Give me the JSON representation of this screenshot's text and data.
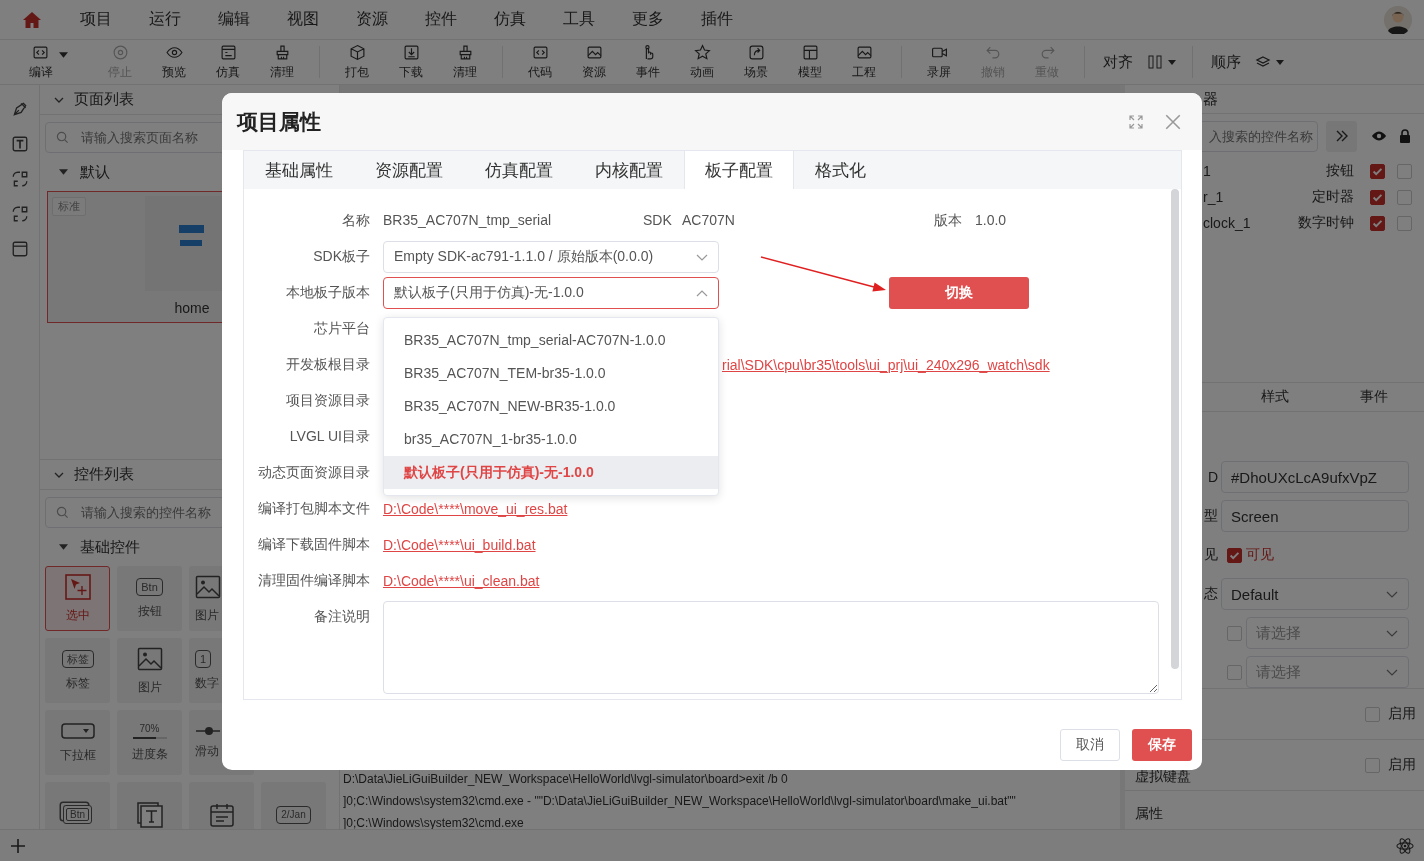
{
  "menu_bar": {
    "items": [
      "项目",
      "运行",
      "编辑",
      "视图",
      "资源",
      "控件",
      "仿真",
      "工具",
      "更多",
      "插件"
    ]
  },
  "toolbar": {
    "groups": [
      [
        {
          "label": "编译",
          "disabled": false,
          "has_menu": true
        },
        {
          "label": "停止",
          "disabled": true,
          "has_menu": false
        },
        {
          "label": "预览",
          "disabled": false,
          "has_menu": false
        },
        {
          "label": "仿真",
          "disabled": false,
          "has_menu": false
        },
        {
          "label": "清理",
          "disabled": false,
          "has_menu": false
        }
      ],
      [
        {
          "label": "打包",
          "disabled": false,
          "has_menu": false
        },
        {
          "label": "下载",
          "disabled": false,
          "has_menu": false
        },
        {
          "label": "清理",
          "disabled": false,
          "has_menu": false
        }
      ],
      [
        {
          "label": "代码",
          "disabled": false,
          "has_menu": false
        },
        {
          "label": "资源",
          "disabled": false,
          "has_menu": false
        },
        {
          "label": "事件",
          "disabled": false,
          "has_menu": false
        },
        {
          "label": "动画",
          "disabled": false,
          "has_menu": false
        },
        {
          "label": "场景",
          "disabled": false,
          "has_menu": false
        },
        {
          "label": "模型",
          "disabled": false,
          "has_menu": false
        },
        {
          "label": "工程",
          "disabled": false,
          "has_menu": false
        }
      ],
      [
        {
          "label": "录屏",
          "disabled": false,
          "has_menu": false
        },
        {
          "label": "撤销",
          "disabled": true,
          "has_menu": false
        },
        {
          "label": "重做",
          "disabled": true,
          "has_menu": false
        }
      ]
    ],
    "align": {
      "label": "对齐"
    },
    "order": {
      "label": "顺序"
    }
  },
  "page_list": {
    "title": "页面列表",
    "search": {
      "placeholder": "请输入搜索页面名称"
    },
    "group": {
      "label": "默认",
      "expanded": true
    },
    "pages": [
      {
        "badge": "标准",
        "name": "home",
        "selected": true
      }
    ]
  },
  "widget_list": {
    "title": "控件列表",
    "search": {
      "placeholder": "请输入搜索的控件名称"
    },
    "group": {
      "label": "基础控件",
      "expanded": true
    },
    "rows": [
      [
        {
          "kind": "pointer",
          "label": "选中",
          "selected": true
        },
        {
          "kind": "button",
          "icon_text": "Btn",
          "label": "按钮",
          "selected": false
        },
        {
          "kind": "image-button",
          "label": "图片",
          "selected": false
        }
      ],
      [
        {
          "kind": "label",
          "icon_text": "标签",
          "label": "标签",
          "selected": false
        },
        {
          "kind": "image",
          "label": "图片",
          "selected": false
        },
        {
          "kind": "number",
          "icon_text": "1",
          "label": "数字",
          "selected": false
        }
      ],
      [
        {
          "kind": "dropdown",
          "label": "下拉框",
          "selected": false
        },
        {
          "kind": "progress",
          "icon_text": "70%",
          "label": "进度条",
          "selected": false
        },
        {
          "kind": "slider",
          "label": "滑动",
          "selected": false
        }
      ],
      [
        {
          "kind": "button-matrix",
          "icon_text": "Btn",
          "selected": false
        },
        {
          "kind": "textarea",
          "selected": false
        },
        {
          "kind": "calendar",
          "selected": false
        },
        {
          "kind": "date",
          "icon_text": "2/Jan",
          "selected": false
        }
      ]
    ]
  },
  "console": {
    "lines": [
      "D:\\Data\\JieLiGuiBuilder_NEW_Workspace\\HelloWorld\\lvgl-simulator\\board>exit /b 0",
      "]0;C:\\Windows\\system32\\cmd.exe - \"\"D:\\Data\\JieLiGuiBuilder_NEW_Workspace\\HelloWorld\\lvgl-simulator\\board\\make_ui.bat\"\"",
      "]0;C:\\Windows\\system32\\cmd.exe"
    ]
  },
  "widget_tree": {
    "title": "器",
    "search": {
      "placeholder": "入搜索的控件名称"
    },
    "rows": [
      {
        "name": "1",
        "type": "按钮",
        "visible": true,
        "locked": false
      },
      {
        "name": "r_1",
        "type": "定时器",
        "visible": true,
        "locked": false
      },
      {
        "name": "clock_1",
        "type": "数字时钟",
        "visible": true,
        "locked": false
      }
    ]
  },
  "inspector": {
    "tabs": [
      {
        "label": "样式",
        "selected": false
      },
      {
        "label": "事件",
        "selected": false
      }
    ],
    "fields": [
      {
        "kind": "text",
        "label": "D",
        "value": "#DhoUXcLcA9ufxVpZ"
      },
      {
        "kind": "text",
        "label": "型",
        "value": "Screen"
      },
      {
        "kind": "check",
        "label": "见",
        "checked": true,
        "text": "可见"
      },
      {
        "kind": "select",
        "label": "态",
        "value": "Default"
      },
      {
        "kind": "check-select",
        "checked": false,
        "placeholder": "请选择"
      },
      {
        "kind": "check-select",
        "checked": false,
        "placeholder": "请选择"
      }
    ],
    "options": [
      {
        "checked": false,
        "text": "启用"
      },
      {
        "label": "虚拟键盘",
        "checked": false,
        "text": "启用"
      }
    ],
    "section": "属性"
  },
  "dialog": {
    "title": "项目属性",
    "tabs": [
      {
        "label": "基础属性",
        "selected": false
      },
      {
        "label": "资源配置",
        "selected": false
      },
      {
        "label": "仿真配置",
        "selected": false
      },
      {
        "label": "内核配置",
        "selected": false
      },
      {
        "label": "板子配置",
        "selected": true
      },
      {
        "label": "格式化",
        "selected": false
      }
    ],
    "info": [
      {
        "label": "名称",
        "value": "BR35_AC707N_tmp_serial"
      },
      {
        "label": "SDK",
        "value": "AC707N"
      },
      {
        "label": "版本",
        "value": "1.0.0"
      }
    ],
    "sdk_board": {
      "label": "SDK板子",
      "value": "Empty SDK-ac791-1.1.0 / 原始版本(0.0.0)"
    },
    "local_board": {
      "label": "本地板子版本",
      "value": "默认板子(只用于仿真)-无-1.0.0",
      "expanded": true,
      "options": [
        {
          "label": "BR35_AC707N_tmp_serial-AC707N-1.0.0",
          "selected": false
        },
        {
          "label": "BR35_AC707N_TEM-br35-1.0.0",
          "selected": false
        },
        {
          "label": "BR35_AC707N_NEW-BR35-1.0.0",
          "selected": false
        },
        {
          "label": "br35_AC707N_1-br35-1.0.0",
          "selected": false
        },
        {
          "label": "默认板子(只用于仿真)-无-1.0.0",
          "selected": true
        }
      ]
    },
    "switch_button": {
      "label": "切换"
    },
    "rows": [
      {
        "label": "芯片平台"
      },
      {
        "label": "开发板根目录",
        "link": "rial\\SDK\\cpu\\br35\\tools\\ui_prj\\ui_240x296_watch\\sdk"
      },
      {
        "label": "项目资源目录"
      },
      {
        "label": "LVGL UI目录"
      },
      {
        "label": "动态页面资源目录"
      },
      {
        "label": "编译打包脚本文件",
        "link": "D:\\Code\\****\\move_ui_res.bat"
      },
      {
        "label": "编译下载固件脚本",
        "link": "D:\\Code\\****\\ui_build.bat"
      },
      {
        "label": "清理固件编译脚本",
        "link": "D:\\Code\\****\\ui_clean.bat"
      }
    ],
    "notes": {
      "label": "备注说明"
    },
    "buttons": [
      {
        "label": "取消",
        "kind": "secondary"
      },
      {
        "label": "保存",
        "kind": "primary"
      }
    ]
  }
}
